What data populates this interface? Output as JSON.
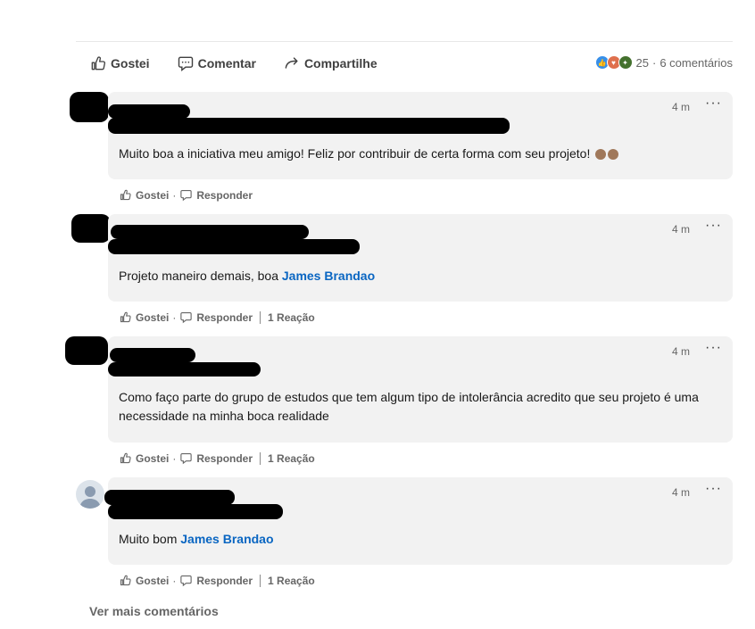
{
  "actions": {
    "like": "Gostei",
    "comment": "Comentar",
    "share": "Compartilhe"
  },
  "social": {
    "reactions": "25",
    "separator": "·",
    "comments": "6 comentários"
  },
  "comments": [
    {
      "time": "4 m",
      "more": "···",
      "text": "Muito boa a iniciativa meu amigo! Feliz por contribuir de certa forma com seu projeto!",
      "emojis": [
        "clapping-hands",
        "clapping-hands"
      ],
      "like": "Gostei",
      "reply": "Responder"
    },
    {
      "time": "4 m",
      "more": "···",
      "text_before": "Projeto maneiro demais, boa ",
      "mention": "James Brandao",
      "like": "Gostei",
      "reply": "Responder",
      "reactions": "1 Reação"
    },
    {
      "time": "4 m",
      "more": "···",
      "text": "Como faço parte do grupo de estudos que tem algum tipo de intolerância acredito que seu projeto é uma necessidade na minha boca realidade",
      "like": "Gostei",
      "reply": "Responder",
      "reactions": "1 Reação"
    },
    {
      "time": "4 m",
      "more": "···",
      "text_before": "Muito bom ",
      "mention": "James Brandao",
      "like": "Gostei",
      "reply": "Responder",
      "reactions": "1 Reação"
    }
  ],
  "see_more": "Ver mais comentários",
  "colors": {
    "accent": "#0a66c2",
    "bubble": "#f2f2f2",
    "muted": "#666666"
  }
}
